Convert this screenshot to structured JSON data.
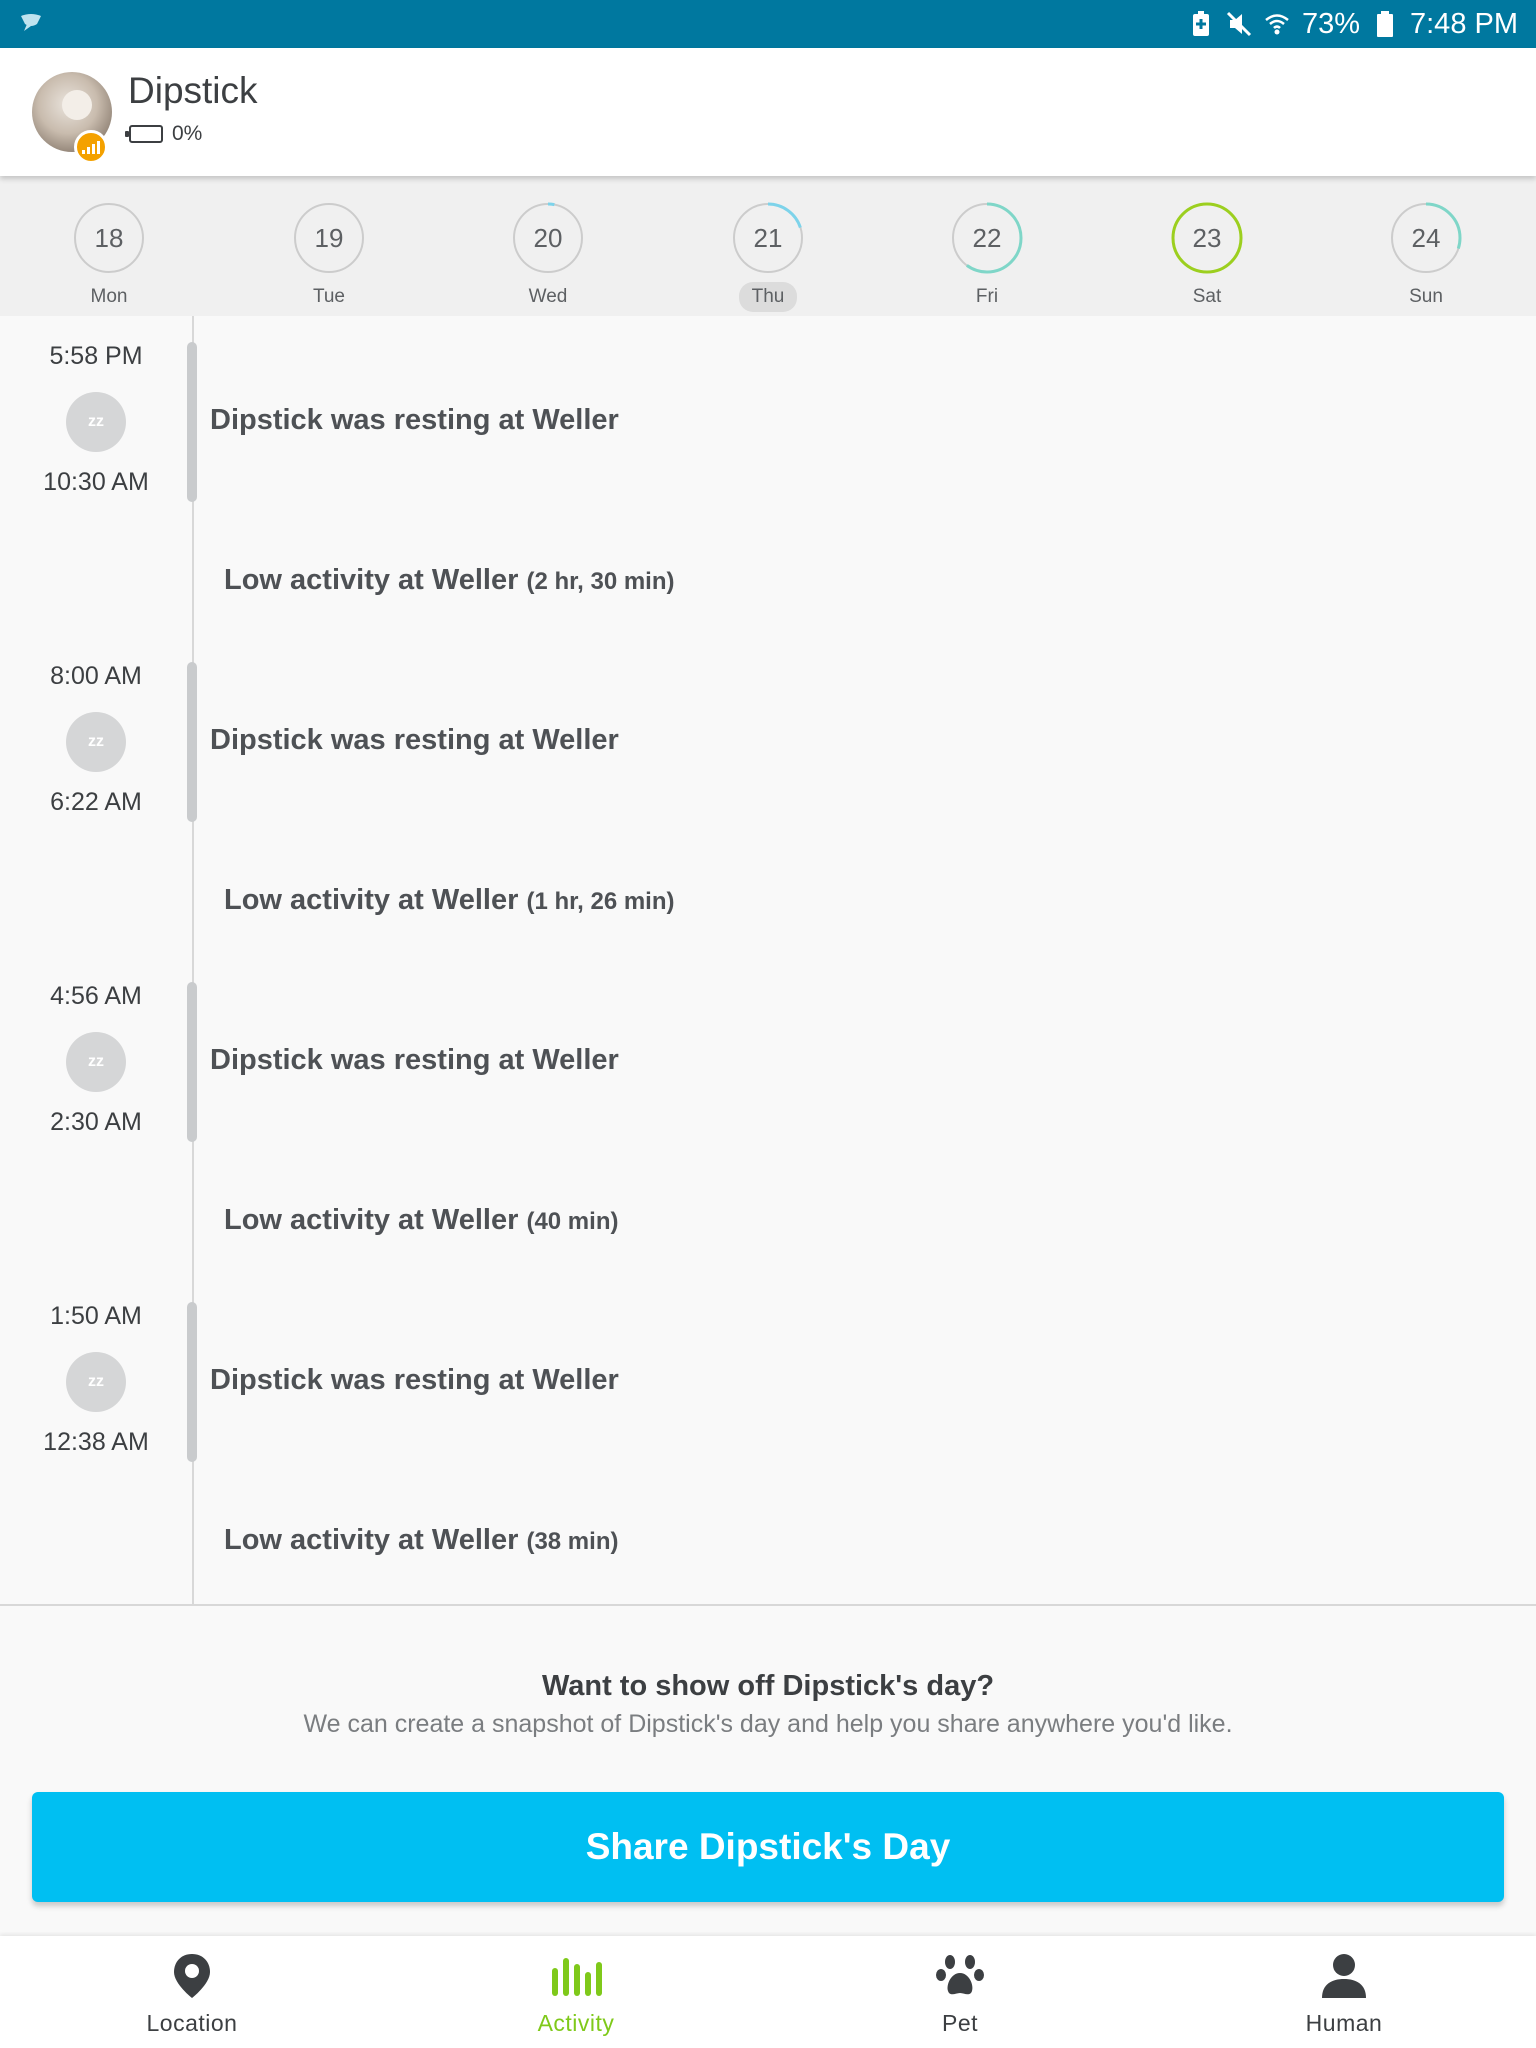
{
  "status_bar": {
    "battery_percent": "73%",
    "time": "7:48 PM"
  },
  "header": {
    "pet_name": "Dipstick",
    "battery_level": "0%"
  },
  "week": {
    "days": [
      {
        "num": "18",
        "dow": "Mon",
        "progress": 0,
        "color": "#cccccc",
        "selected": false
      },
      {
        "num": "19",
        "dow": "Tue",
        "progress": 0,
        "color": "#cccccc",
        "selected": false
      },
      {
        "num": "20",
        "dow": "Wed",
        "progress": 0.03,
        "color": "#7dd3ea",
        "selected": false
      },
      {
        "num": "21",
        "dow": "Thu",
        "progress": 0.2,
        "color": "#7dd3ea",
        "selected": true
      },
      {
        "num": "22",
        "dow": "Fri",
        "progress": 0.6,
        "color": "#7fd6c8",
        "selected": false
      },
      {
        "num": "23",
        "dow": "Sat",
        "progress": 1.0,
        "color": "#9ccf1f",
        "selected": false
      },
      {
        "num": "24",
        "dow": "Sun",
        "progress": 0.3,
        "color": "#7fd6c8",
        "selected": false
      }
    ]
  },
  "timeline": [
    {
      "end_time": "5:58 PM",
      "start_time": "10:30 AM",
      "rest_text": "Dipstick was resting at Weller",
      "low_text": "Low activity at Weller",
      "low_duration": "(2 hr, 30 min)"
    },
    {
      "end_time": "8:00 AM",
      "start_time": "6:22 AM",
      "rest_text": "Dipstick was resting at Weller",
      "low_text": "Low activity at Weller",
      "low_duration": "(1 hr, 26 min)"
    },
    {
      "end_time": "4:56 AM",
      "start_time": "2:30 AM",
      "rest_text": "Dipstick was resting at Weller",
      "low_text": "Low activity at Weller",
      "low_duration": "(40 min)"
    },
    {
      "end_time": "1:50 AM",
      "start_time": "12:38 AM",
      "rest_text": "Dipstick was resting at Weller",
      "low_text": "Low activity at Weller",
      "low_duration": "(38 min)"
    }
  ],
  "rest_icon": "zz",
  "share": {
    "title": "Want to show off Dipstick's day?",
    "subtitle": "We can create a snapshot of Dipstick's day and help you share anywhere you'd like.",
    "button_label": "Share Dipstick's Day"
  },
  "nav": {
    "items": [
      {
        "label": "Location",
        "icon": "location-pin-icon",
        "active": false
      },
      {
        "label": "Activity",
        "icon": "activity-bars-icon",
        "active": true
      },
      {
        "label": "Pet",
        "icon": "paw-icon",
        "active": false
      },
      {
        "label": "Human",
        "icon": "person-icon",
        "active": false
      }
    ]
  }
}
